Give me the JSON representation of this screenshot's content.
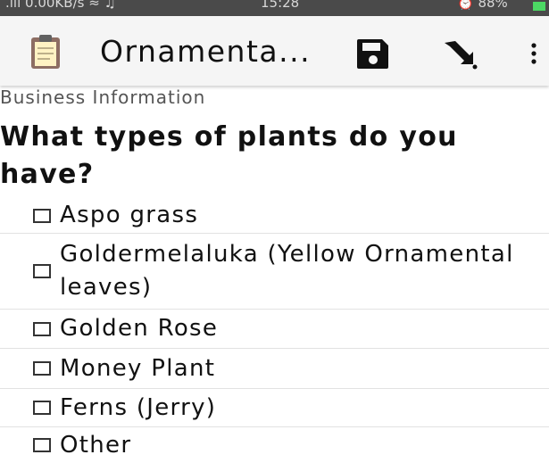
{
  "status_bar": {
    "left": ".ııl 0.00KB/s ≈ ♫",
    "time": "15:28",
    "right": "⏰ 88%"
  },
  "app_bar": {
    "title": "Ornamenta...",
    "icons": [
      "clipboard-icon",
      "save-icon",
      "send-icon",
      "more-vert-icon"
    ]
  },
  "form": {
    "section_label": "Business Information",
    "question": "What types of plants do you have?",
    "options": [
      {
        "label": "Aspo grass",
        "checked": false
      },
      {
        "label": "Goldermelaluka (Yellow Ornamental leaves)",
        "checked": false
      },
      {
        "label": "Golden Rose",
        "checked": false
      },
      {
        "label": "Money Plant",
        "checked": false
      },
      {
        "label": "Ferns (Jerry)",
        "checked": false
      },
      {
        "label": "Other",
        "checked": false
      }
    ]
  }
}
